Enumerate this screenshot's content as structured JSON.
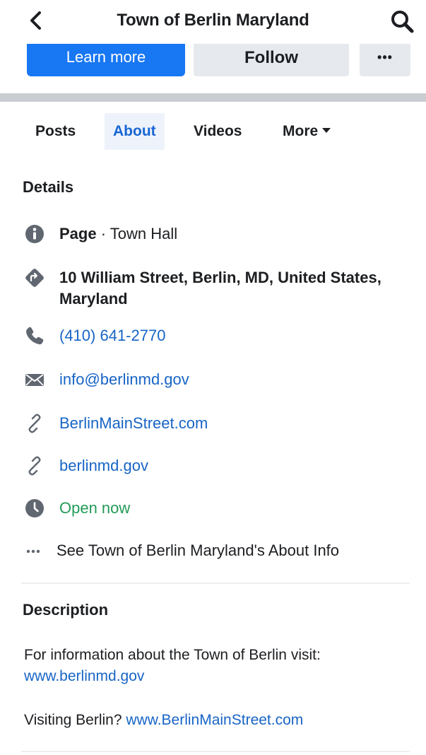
{
  "header": {
    "title": "Town of Berlin Maryland",
    "back_icon": "chevron-left-icon",
    "search_icon": "search-icon"
  },
  "actions": {
    "learn_more": "Learn more",
    "follow": "Follow",
    "more": "•••"
  },
  "tabs": [
    {
      "label": "Posts"
    },
    {
      "label": "About",
      "active": true
    },
    {
      "label": "Videos"
    },
    {
      "label": "More"
    }
  ],
  "details": {
    "title": "Details",
    "page_label": "Page",
    "page_separator": " · ",
    "page_category": "Town Hall",
    "address": "10 William Street, Berlin, MD, United States, Maryland",
    "phone": "(410) 641-2770",
    "email": "info@berlinmd.gov",
    "website_1": "BerlinMainStreet.com",
    "website_2": "berlinmd.gov",
    "hours": "Open now",
    "see_about": "See Town of Berlin Maryland's About Info"
  },
  "description": {
    "title": "Description",
    "line1_text": "For information about the Town of Berlin visit:",
    "line1_link": "www.berlinmd.gov",
    "line2_text": "Visiting Berlin? ",
    "line2_link": "www.BerlinMainStreet.com"
  },
  "colors": {
    "accent": "#1877f2",
    "link": "#1865c6",
    "open": "#239b56",
    "icon": "#606770"
  }
}
